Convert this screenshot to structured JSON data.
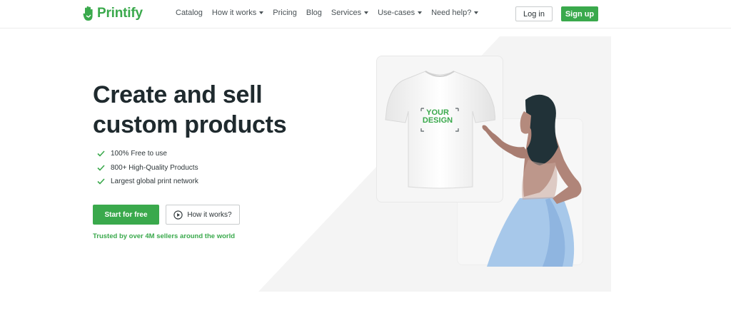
{
  "header": {
    "logo_text": "Printify",
    "nav": [
      {
        "label": "Catalog",
        "has_caret": false
      },
      {
        "label": "How it works",
        "has_caret": true
      },
      {
        "label": "Pricing",
        "has_caret": false
      },
      {
        "label": "Blog",
        "has_caret": false
      },
      {
        "label": "Services",
        "has_caret": true
      },
      {
        "label": "Use-cases",
        "has_caret": true
      },
      {
        "label": "Need help?",
        "has_caret": true
      }
    ],
    "login_label": "Log in",
    "signup_label": "Sign up"
  },
  "hero": {
    "title_line1": "Create and sell",
    "title_line2": "custom products",
    "features": [
      "100% Free to use",
      "800+ High-Quality Products",
      "Largest global print network"
    ],
    "start_label": "Start for free",
    "how_label": "How it works?",
    "trusted_text": "Trusted by over 4M sellers around the world",
    "design_line1": "YOUR",
    "design_line2": "DESIGN"
  },
  "colors": {
    "brand_green": "#3aa94c",
    "text_dark": "#1f2a2e"
  },
  "icons": {
    "logo": "printify-hand-icon",
    "check": "check-icon",
    "play": "play-circle-icon",
    "caret": "caret-down-icon"
  }
}
